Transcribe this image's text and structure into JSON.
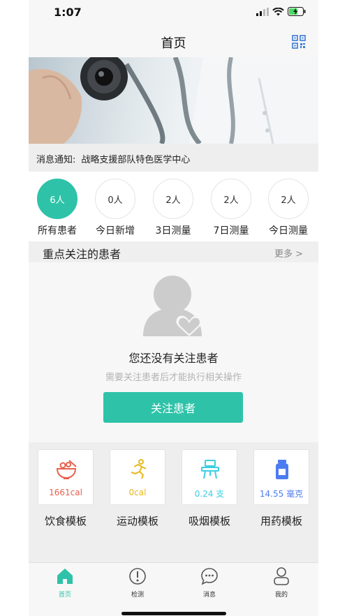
{
  "status_bar": {
    "time": "1:07"
  },
  "nav": {
    "title": "首页",
    "qr_icon": "qr-code-icon"
  },
  "notice": {
    "label": "消息通知:",
    "content": "战略支援部队特色医学中心"
  },
  "stats": [
    {
      "value": "6人",
      "label": "所有患者",
      "active": true
    },
    {
      "value": "0人",
      "label": "今日新增",
      "active": false
    },
    {
      "value": "2人",
      "label": "3日测量",
      "active": false
    },
    {
      "value": "2人",
      "label": "7日测量",
      "active": false
    },
    {
      "value": "2人",
      "label": "今日测量",
      "active": false
    }
  ],
  "focus_section": {
    "title": "重点关注的患者",
    "more": "更多 >"
  },
  "empty_state": {
    "title": "您还没有关注患者",
    "description": "需要关注患者后才能执行相关操作",
    "button": "关注患者"
  },
  "templates": [
    {
      "value": "1661cal",
      "label": "饮食模板",
      "icon": "food-bowl-icon",
      "color": "#e8604c"
    },
    {
      "value": "0cal",
      "label": "运动模板",
      "icon": "running-icon",
      "color": "#e8b820"
    },
    {
      "value": "0.24 支",
      "label": "吸烟模板",
      "icon": "smoking-icon",
      "color": "#3ccfe0"
    },
    {
      "value": "14.55 毫克",
      "label": "用药模板",
      "icon": "medicine-bottle-icon",
      "color": "#4c7cf0"
    }
  ],
  "tabs": [
    {
      "label": "首页",
      "icon": "home-icon",
      "active": true
    },
    {
      "label": "检测",
      "icon": "detection-icon",
      "active": false
    },
    {
      "label": "消息",
      "icon": "message-icon",
      "active": false
    },
    {
      "label": "我的",
      "icon": "profile-icon",
      "active": false
    }
  ],
  "colors": {
    "accent": "#2ec3a8"
  }
}
